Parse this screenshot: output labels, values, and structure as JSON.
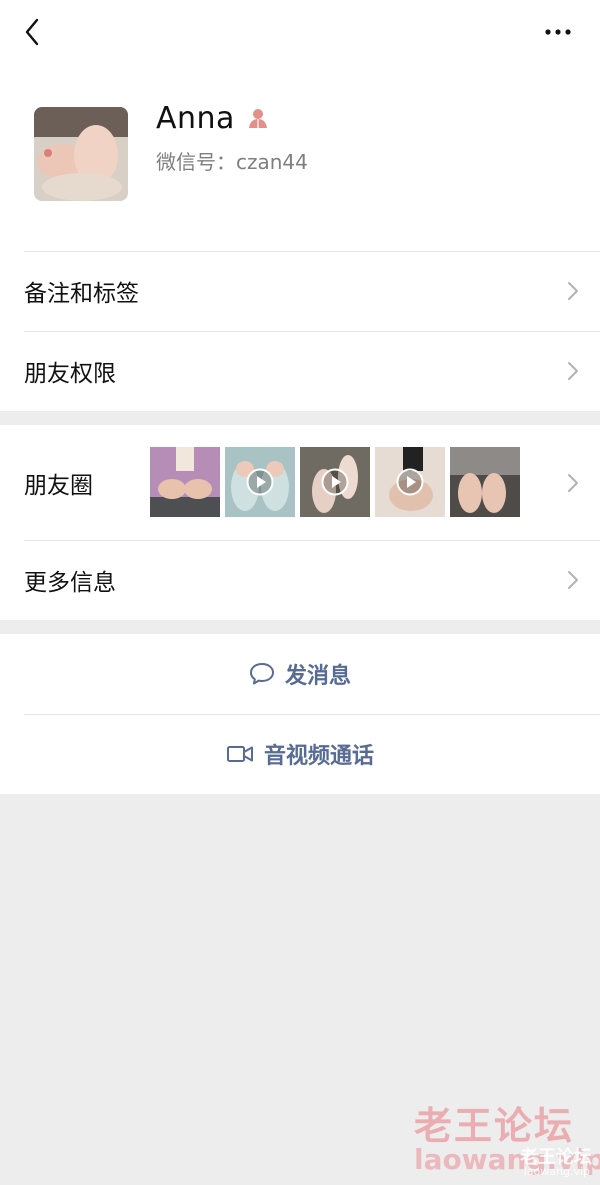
{
  "profile": {
    "name": "Anna",
    "wechat_id_text": "微信号：czan44",
    "gender_icon": "female-icon"
  },
  "menu": {
    "remark_tags": "备注和标签",
    "friend_permissions": "朋友权限",
    "moments": "朋友圈",
    "more_info": "更多信息"
  },
  "moments_thumbs": [
    {
      "has_video": false,
      "bg": "#b58db7"
    },
    {
      "has_video": true,
      "bg": "#a9c2c4"
    },
    {
      "has_video": true,
      "bg": "#6f6a62"
    },
    {
      "has_video": true,
      "bg": "#d9c9bd"
    },
    {
      "has_video": false,
      "bg": "#4f4b49"
    }
  ],
  "actions": {
    "send_message": "发消息",
    "video_call": "音视频通话"
  },
  "watermark": {
    "line1": "老王论坛",
    "line2": "laowang.vip",
    "line3": "老王论坛",
    "line4": "laowang.vip"
  },
  "colors": {
    "link_blue": "#576b95",
    "background": "#ededed",
    "gender_red": "#e58f8a"
  }
}
